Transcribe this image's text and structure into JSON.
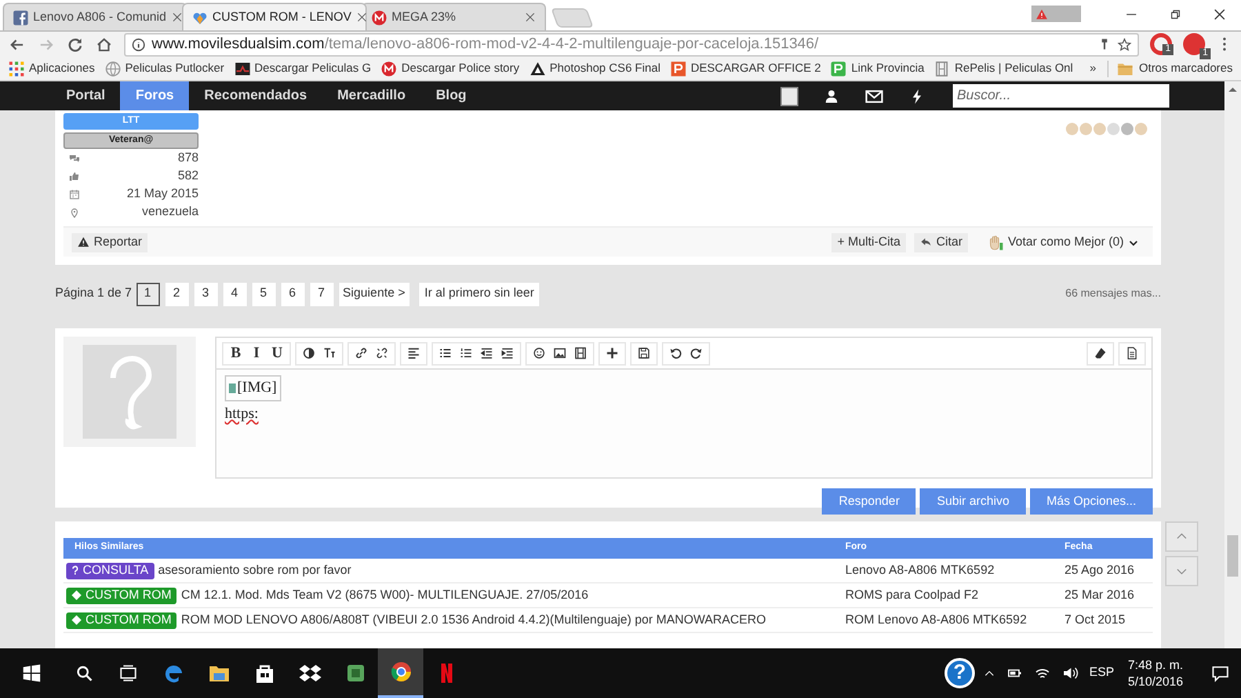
{
  "browser": {
    "tabs": [
      {
        "label": "Lenovo A806 - Comunid",
        "kind": "facebook",
        "selected": false
      },
      {
        "label": "CUSTOM ROM - LENOV",
        "kind": "heart",
        "selected": true
      },
      {
        "label": "MEGA 23%",
        "kind": "mega",
        "selected": false
      }
    ],
    "address": {
      "host": "www.movilesdualsim.com",
      "path": "/tema/lenovo-a806-rom-mod-v2-4-4-2-multilenguaje-por-caceloja.151346/"
    },
    "extension_badges": [
      "1",
      "1"
    ],
    "bookmarks": [
      {
        "label": "Aplicaciones",
        "kind": "apps"
      },
      {
        "label": "Peliculas Putlocker",
        "kind": "globe"
      },
      {
        "label": "Descargar Peliculas G",
        "kind": "thumb"
      },
      {
        "label": "Descargar Police story",
        "kind": "mega"
      },
      {
        "label": "Photoshop CS6 Final",
        "kind": "triangle"
      },
      {
        "label": "DESCARGAR OFFICE 2",
        "kind": "orange"
      },
      {
        "label": "Link Provincia",
        "kind": "green"
      },
      {
        "label": "RePelis | Peliculas Onl",
        "kind": "film"
      }
    ],
    "bookmarks_more": "»",
    "other_bookmarks": "Otros marcadores"
  },
  "nav": {
    "items": [
      {
        "label": "Portal",
        "selected": false
      },
      {
        "label": "Foros",
        "selected": true
      },
      {
        "label": "Recomendados",
        "selected": false
      },
      {
        "label": "Mercadillo",
        "selected": false
      },
      {
        "label": "Blog",
        "selected": false
      }
    ],
    "search": {
      "placeholder": "Buscor..."
    }
  },
  "post": {
    "badges": [
      {
        "label": "LTT",
        "kind": "primary"
      },
      {
        "label": "Veteran@",
        "kind": "secondary"
      }
    ],
    "stats": [
      {
        "kind": "messages",
        "value": "878"
      },
      {
        "kind": "likes",
        "value": "582"
      },
      {
        "kind": "joined",
        "value": "21 May 2015"
      },
      {
        "kind": "location",
        "value": "venezuela"
      }
    ],
    "report": "Reportar",
    "multiquote": "+ Multi-Cita",
    "quote": "Citar",
    "vote": "Votar como Mejor (0)"
  },
  "pagination": {
    "label": "Página 1 de 7",
    "pages": [
      {
        "label": "1",
        "selected": true
      },
      {
        "label": "2",
        "selected": false
      },
      {
        "label": "3",
        "selected": false
      },
      {
        "label": "4",
        "selected": false
      },
      {
        "label": "5",
        "selected": false
      },
      {
        "label": "6",
        "selected": false
      },
      {
        "label": "7",
        "selected": false
      }
    ],
    "next": "Siguiente >",
    "first_unread": "Ir al primero sin leer",
    "more": "66 mensajes mas..."
  },
  "editor": {
    "toolbar": [
      [
        {
          "kind": "glyph",
          "text": "B"
        },
        {
          "kind": "glyph",
          "text": "I"
        },
        {
          "kind": "glyph",
          "text": "U"
        }
      ],
      [
        {
          "kind": "contrast"
        },
        {
          "kind": "textsize"
        }
      ],
      [
        {
          "kind": "link"
        },
        {
          "kind": "unlink"
        }
      ],
      [
        {
          "kind": "align"
        }
      ],
      [
        {
          "kind": "bullets"
        },
        {
          "kind": "numbers"
        },
        {
          "kind": "outdent"
        },
        {
          "kind": "indent"
        }
      ],
      [
        {
          "kind": "smiley"
        },
        {
          "kind": "image"
        },
        {
          "kind": "film"
        }
      ],
      [
        {
          "kind": "plus"
        }
      ],
      [
        {
          "kind": "save"
        }
      ],
      [
        {
          "kind": "undo"
        },
        {
          "kind": "redo"
        }
      ]
    ],
    "toolbar_right": [
      {
        "kind": "eraser"
      },
      {
        "kind": "document"
      }
    ],
    "image_alt": "[IMG]",
    "text": "https:",
    "buttons": [
      "Responder",
      "Subir archivo",
      "Más Opciones..."
    ]
  },
  "similar": {
    "columns": [
      "Hilos Similares",
      "Foro",
      "Fecha"
    ],
    "rows": [
      {
        "tag": {
          "label": "CONSULTA",
          "kind": "question",
          "color": "#6a45c9"
        },
        "title": "asesoramiento sobre rom por favor",
        "forum": "Lenovo A8-A806 MTK6592",
        "date": "25 Ago 2016"
      },
      {
        "tag": {
          "label": "CUSTOM ROM",
          "kind": "diamond",
          "color": "#1e9a2a"
        },
        "title": "CM 12.1. Mod. Mds Team V2 (8675 W00)- MULTILENGUAJE. 27/05/2016",
        "forum": "ROMS para Coolpad F2",
        "date": "25 Mar 2016"
      },
      {
        "tag": {
          "label": "CUSTOM ROM",
          "kind": "diamond",
          "color": "#1e9a2a"
        },
        "title": "ROM MOD LENOVO A806/A808T (VIBEUI 2.0 1536 Android 4.4.2)(Multilenguaje) por MANOWARACERO",
        "forum": "ROM Lenovo A8-A806 MTK6592",
        "date": "7 Oct 2015"
      }
    ]
  },
  "taskbar": {
    "help": "?",
    "language": "ESP",
    "time": "7:48 p. m.",
    "date": "5/10/2016"
  }
}
